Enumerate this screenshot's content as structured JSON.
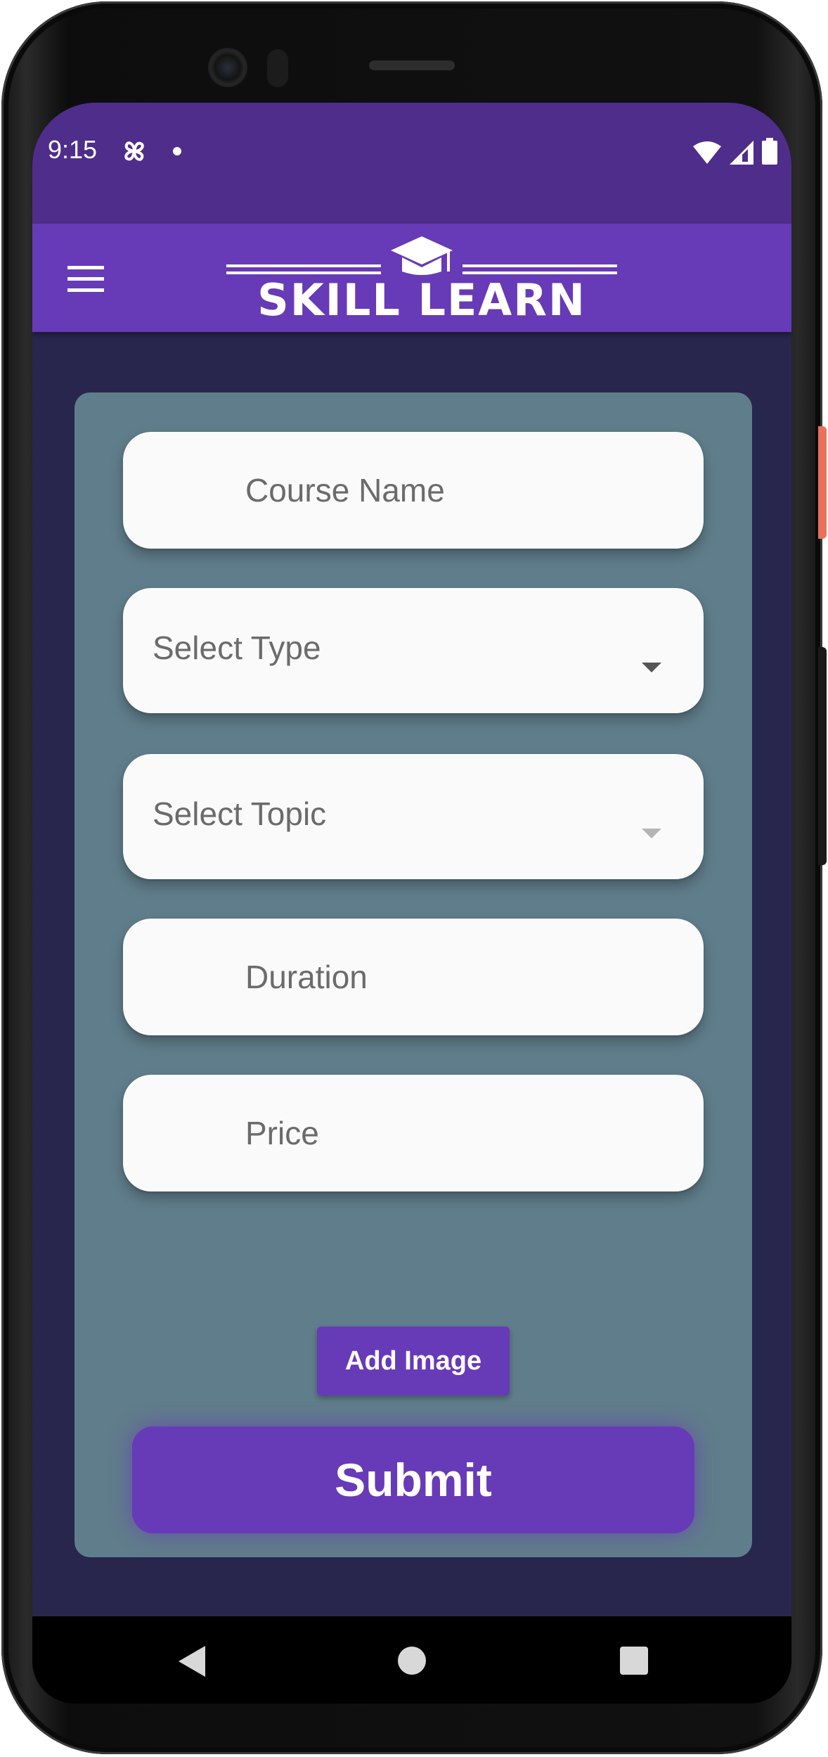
{
  "status_bar": {
    "time": "9:15"
  },
  "app_bar": {
    "logo_text": "SKILL LEARN"
  },
  "form": {
    "course_name_placeholder": "Course Name",
    "type_placeholder": "Select Type",
    "topic_placeholder": "Select Topic",
    "duration_placeholder": "Duration",
    "price_placeholder": "Price",
    "add_image_label": "Add Image",
    "submit_label": "Submit"
  },
  "icons": {
    "menu": "hamburger-menu-icon",
    "logo": "graduation-cap-icon",
    "fan": "fan-notification-icon",
    "wifi": "wifi-icon",
    "signal": "cellular-signal-icon",
    "battery": "battery-icon",
    "dropdown": "caret-down-icon",
    "nav_back": "back-triangle-icon",
    "nav_home": "home-circle-icon",
    "nav_recents": "recents-square-icon"
  },
  "colors": {
    "status_bar": "#4f2d8b",
    "app_bar": "#673ab7",
    "background": "#28264c",
    "card": "#607d8b",
    "field": "#fafafa",
    "button": "#673ab7"
  }
}
